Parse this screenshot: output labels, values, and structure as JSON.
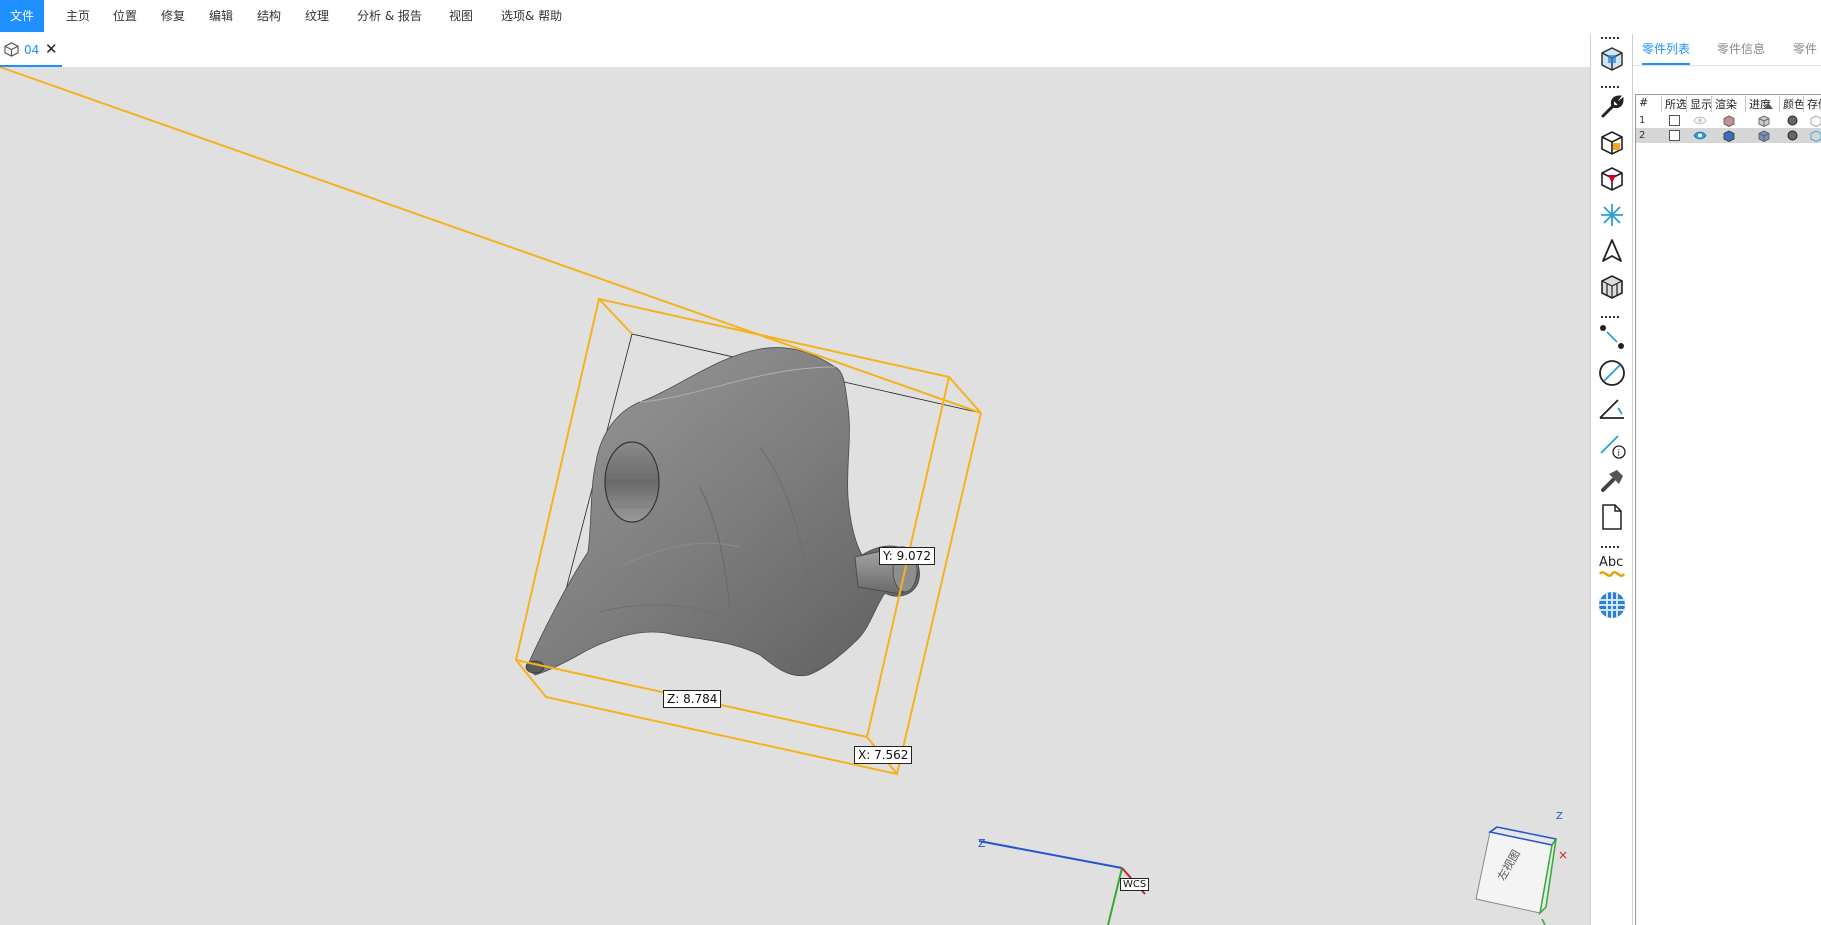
{
  "menu": {
    "items": [
      "文件",
      "主页",
      "位置",
      "修复",
      "编辑",
      "结构",
      "纹理",
      "分析 & 报告",
      "视图",
      "选项& 帮助"
    ]
  },
  "document_tab": {
    "label": "04"
  },
  "viewport": {
    "dimensions": {
      "y_label": "Y: 9.072",
      "z_label": "Z: 8.784",
      "x_label": "X: 7.562"
    },
    "axis": {
      "z": "Z",
      "wcs": "WCS"
    },
    "viewcube": {
      "face_label": "左视图"
    }
  },
  "toolbar": {
    "icons": [
      "part-3d-icon",
      "wrench-icon",
      "box-select-icon",
      "box-red-icon",
      "snowflake-icon",
      "arrow-icon",
      "mesh-box-icon",
      "point-distance-icon",
      "diameter-icon",
      "angle-icon",
      "measure-info-icon",
      "hammer-icon",
      "document-icon",
      "abc-text-icon",
      "wave-icon",
      "grid-sphere-icon"
    ]
  },
  "panel": {
    "tabs": [
      "零件列表",
      "零件信息",
      "零件"
    ],
    "columns": [
      "#",
      "所选",
      "显示",
      "渲染",
      "进度",
      "颜色",
      "存储"
    ],
    "rows": [
      {
        "num": "1",
        "selected": false,
        "visible": false
      },
      {
        "num": "2",
        "selected": false,
        "visible": true
      }
    ]
  },
  "colors": {
    "accent": "#1e90ff",
    "bbox": "#f5b21e",
    "viewport_bg": "#e0e0e0"
  }
}
